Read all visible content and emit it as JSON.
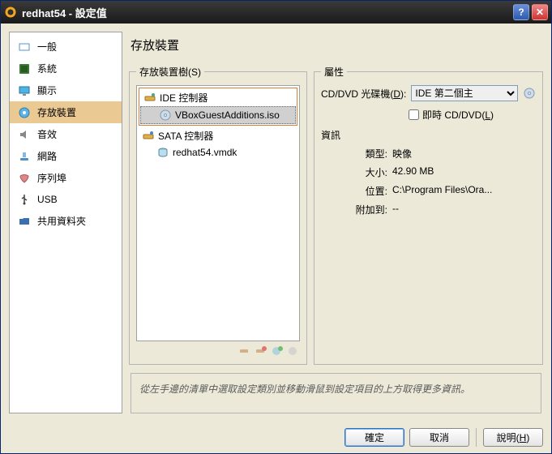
{
  "window": {
    "title": "redhat54 - 設定值"
  },
  "sidebar": {
    "items": [
      {
        "label": "一般"
      },
      {
        "label": "系統"
      },
      {
        "label": "顯示"
      },
      {
        "label": "存放裝置"
      },
      {
        "label": "音效"
      },
      {
        "label": "網路"
      },
      {
        "label": "序列埠"
      },
      {
        "label": "USB"
      },
      {
        "label": "共用資料夾"
      }
    ]
  },
  "content": {
    "title": "存放裝置",
    "tree_legend": "存放裝置樹(S)",
    "attrs_legend": "屬性",
    "info_legend": "資訊",
    "tree": {
      "ide_label": "IDE 控制器",
      "iso_label": "VBoxGuestAdditions.iso",
      "sata_label": "SATA 控制器",
      "vmdk_label": "redhat54.vmdk"
    },
    "attrs": {
      "drive_label_pre": "CD/DVD 光碟機(",
      "drive_label_key": "D",
      "drive_label_post": "):",
      "drive_value": "IDE 第二個主",
      "livecd_pre": "即時 CD/DVD(",
      "livecd_key": "L",
      "livecd_post": ")"
    },
    "info": {
      "type_k": "類型:",
      "type_v": "映像",
      "size_k": "大小:",
      "size_v": "42.90 MB",
      "loc_k": "位置:",
      "loc_v": "C:\\Program Files\\Ora...",
      "att_k": "附加到:",
      "att_v": "--"
    },
    "hint": "從左手邊的清單中選取設定類別並移動滑鼠到設定項目的上方取得更多資訊。"
  },
  "buttons": {
    "ok": "確定",
    "cancel": "取消",
    "help_pre": "說明(",
    "help_key": "H",
    "help_post": ")"
  }
}
